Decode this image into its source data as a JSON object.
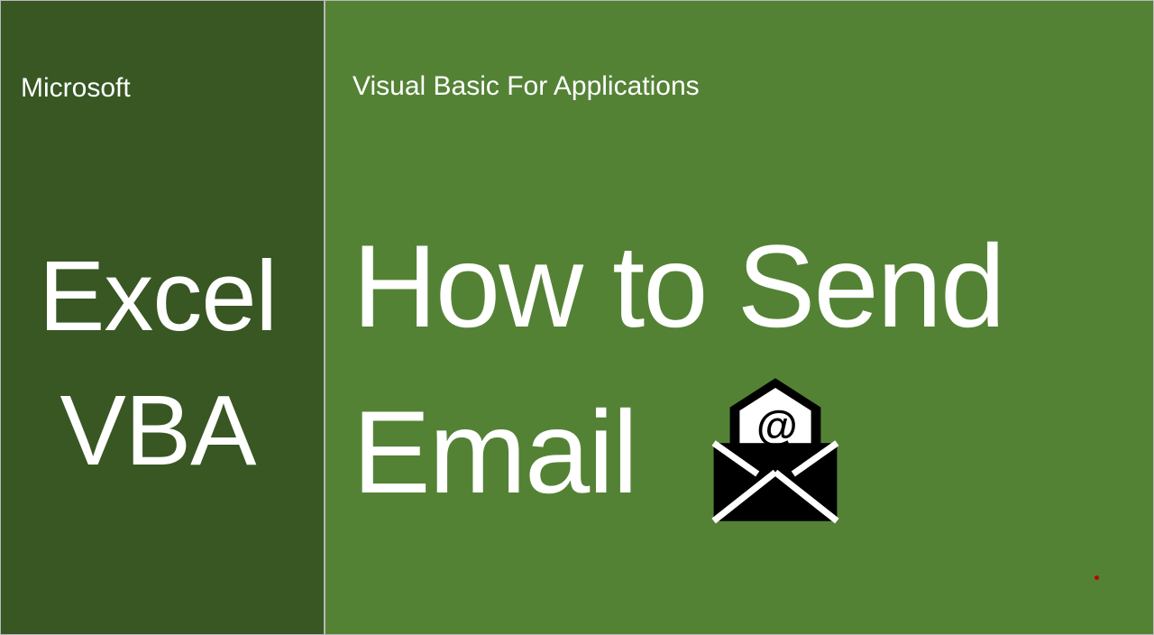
{
  "left": {
    "small": "Microsoft",
    "big_line1": "Excel",
    "big_line2": "VBA"
  },
  "right": {
    "small": "Visual Basic For Applications",
    "big_line1": "How to Send",
    "big_line2": "Email"
  },
  "colors": {
    "dark_green": "#385723",
    "light_green": "#548235"
  }
}
